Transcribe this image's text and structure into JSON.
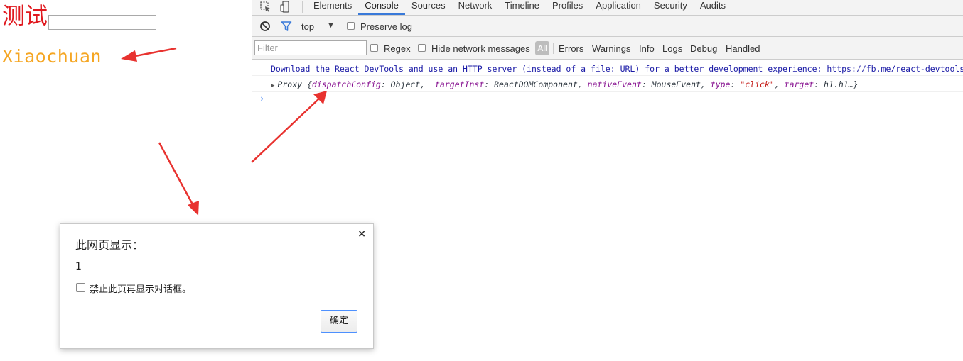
{
  "page": {
    "heading": "测试",
    "input_value": "",
    "name": "Xiaochuan"
  },
  "devtools": {
    "tabs": [
      "Elements",
      "Console",
      "Sources",
      "Network",
      "Timeline",
      "Profiles",
      "Application",
      "Security",
      "Audits"
    ],
    "active_tab": "Console",
    "toolbar": {
      "context": "top",
      "context_arrow": "▼",
      "preserve_log": "Preserve log"
    },
    "filter": {
      "placeholder": "Filter",
      "regex": "Regex",
      "hide_network": "Hide network messages",
      "all": "All",
      "levels": [
        "Errors",
        "Warnings",
        "Info",
        "Logs",
        "Debug",
        "Handled"
      ]
    },
    "console": {
      "line1": "Download the React DevTools and use an HTTP server (instead of a file: URL) for a better development experience: https://fb.me/react-devtools",
      "line2": {
        "expander": "▶",
        "prefix": "Proxy {",
        "k1": "dispatchConfig",
        "v1": ": Object, ",
        "k2": "_targetInst",
        "v2": ": ReactDOMComponent, ",
        "k3": "nativeEvent",
        "v3": ": MouseEvent, ",
        "k4": "type",
        "v4sep": ": ",
        "v4": "\"click\"",
        "sep5": ", ",
        "k5": "target",
        "v5": ": h1.h1…}"
      },
      "prompt": "›"
    }
  },
  "dialog": {
    "title": "此网页显示：",
    "close": "×",
    "message": "1",
    "checkbox_label": "禁止此页再显示对话框。",
    "ok": "确定"
  },
  "colors": {
    "heading": "#e0191f",
    "name": "#f5a623",
    "arrow": "#e8322f",
    "accent": "#3879d9"
  },
  "icons": [
    "inspect-icon",
    "device-icon",
    "clear-console-icon",
    "filter-icon",
    "close-icon"
  ]
}
